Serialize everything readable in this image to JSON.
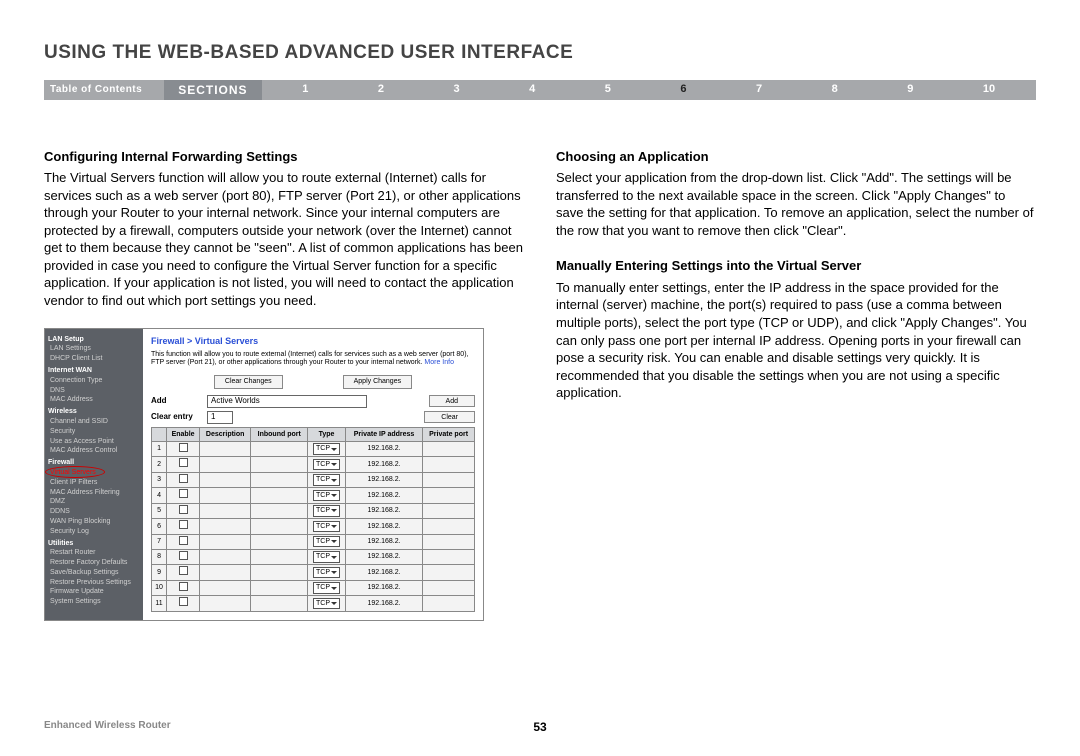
{
  "page_title": "USING THE WEB-BASED ADVANCED USER INTERFACE",
  "nav": {
    "toc": "Table of Contents",
    "sections_label": "SECTIONS",
    "numbers": [
      "1",
      "2",
      "3",
      "4",
      "5",
      "6",
      "7",
      "8",
      "9",
      "10"
    ],
    "active": "6"
  },
  "left": {
    "h1": "Configuring Internal Forwarding Settings",
    "p1": "The Virtual Servers function will allow you to route external (Internet) calls for services such as a web server (port 80), FTP server (Port 21), or other applications through your Router to your internal network. Since your internal computers are protected by a firewall, computers outside your network (over the Internet) cannot get to them because they cannot be \"seen\". A list of common applications has been provided in case you need to configure the Virtual Server function for a specific application. If your application is not listed, you will need to contact the application vendor to find out which port settings you need."
  },
  "right": {
    "h1": "Choosing an Application",
    "p1": "Select your application from the drop-down list. Click \"Add\". The settings will be transferred to the next available space in the screen. Click \"Apply Changes\" to save the setting for that application. To remove an application, select the number of the row that you want to remove then click \"Clear\".",
    "h2": "Manually Entering Settings into the Virtual Server",
    "p2": "To manually enter settings, enter the IP address in the space provided for the internal (server) machine, the port(s) required to pass (use a comma between multiple ports), select the port type (TCP or UDP), and click \"Apply Changes\". You can only pass one port per internal IP address. Opening ports in your firewall can pose a security risk. You can enable and disable settings very quickly. It is recommended that you disable the settings when you are not using a specific application."
  },
  "screenshot": {
    "sidebar": {
      "groups": [
        {
          "header": "LAN Setup",
          "items": [
            "LAN Settings",
            "DHCP Client List"
          ]
        },
        {
          "header": "Internet WAN",
          "items": [
            "Connection Type",
            "DNS",
            "MAC Address"
          ]
        },
        {
          "header": "Wireless",
          "items": [
            "Channel and SSID",
            "Security",
            "Use as Access Point",
            "MAC Address Control"
          ]
        },
        {
          "header": "Firewall",
          "items": [
            "Virtual Servers",
            "Client IP Filters",
            "MAC Address Filtering",
            "DMZ",
            "DDNS",
            "WAN Ping Blocking",
            "Security Log"
          ],
          "active_index": 0
        },
        {
          "header": "Utilities",
          "items": [
            "Restart Router",
            "Restore Factory Defaults",
            "Save/Backup Settings",
            "Restore Previous Settings",
            "Firmware Update",
            "System Settings"
          ]
        }
      ]
    },
    "main": {
      "title": "Firewall > Virtual Servers",
      "desc": "This function will allow you to route external (Internet) calls for services such as a web server (port 80), FTP server (Port 21), or other applications through your Router to your internal network.",
      "more": "More Info",
      "clear_changes": "Clear Changes",
      "apply_changes": "Apply Changes",
      "add_label": "Add",
      "add_value": "Active Worlds",
      "add_btn": "Add",
      "clear_label": "Clear entry",
      "clear_value": "1",
      "clear_btn": "Clear",
      "columns": [
        "",
        "Enable",
        "Description",
        "Inbound port",
        "Type",
        "Private IP address",
        "Private port"
      ],
      "rows": [
        {
          "n": "1",
          "type": "TCP",
          "ip": "192.168.2."
        },
        {
          "n": "2",
          "type": "TCP",
          "ip": "192.168.2."
        },
        {
          "n": "3",
          "type": "TCP",
          "ip": "192.168.2."
        },
        {
          "n": "4",
          "type": "TCP",
          "ip": "192.168.2."
        },
        {
          "n": "5",
          "type": "TCP",
          "ip": "192.168.2."
        },
        {
          "n": "6",
          "type": "TCP",
          "ip": "192.168.2."
        },
        {
          "n": "7",
          "type": "TCP",
          "ip": "192.168.2."
        },
        {
          "n": "8",
          "type": "TCP",
          "ip": "192.168.2."
        },
        {
          "n": "9",
          "type": "TCP",
          "ip": "192.168.2."
        },
        {
          "n": "10",
          "type": "TCP",
          "ip": "192.168.2."
        },
        {
          "n": "11",
          "type": "TCP",
          "ip": "192.168.2."
        }
      ]
    }
  },
  "footer": {
    "product": "Enhanced Wireless Router",
    "page": "53"
  }
}
